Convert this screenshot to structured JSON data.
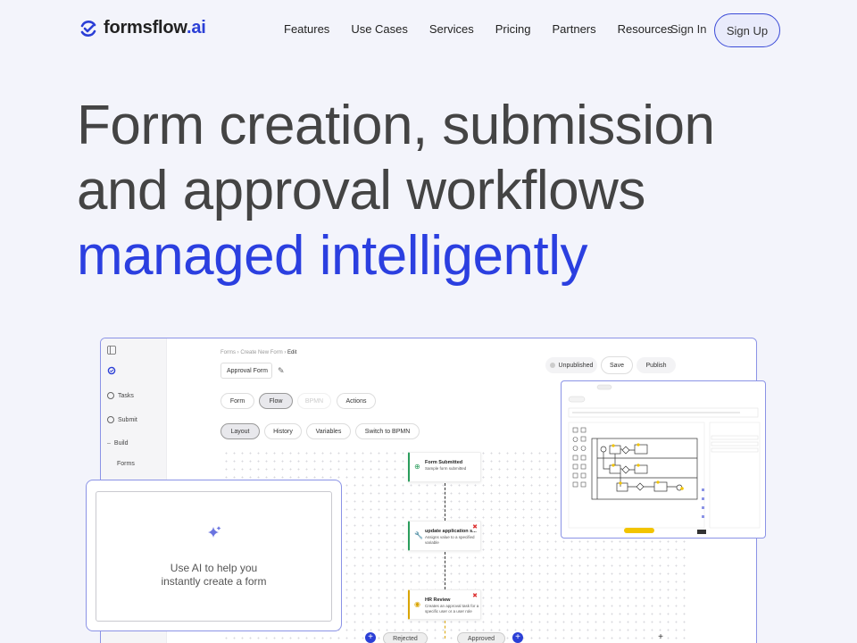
{
  "brand": {
    "name": "formsflow",
    "suffix": ".ai",
    "accent": "#2b3fd6"
  },
  "nav": {
    "links": [
      "Features",
      "Use Cases",
      "Services",
      "Pricing",
      "Partners",
      "Resources"
    ],
    "sign_in": "Sign In",
    "sign_up": "Sign Up"
  },
  "hero": {
    "line1": "Form creation, submission",
    "line2": "and approval workflows",
    "line3": "managed intelligently"
  },
  "app": {
    "sidebar": {
      "tasks": "Tasks",
      "submit": "Submit",
      "build": "Build",
      "forms": "Forms"
    },
    "breadcrumb": {
      "a": "Forms",
      "b": "Create New Form",
      "c": "Edit"
    },
    "form_name": "Approval Form",
    "status": "Unpublished",
    "save": "Save",
    "publish": "Publish",
    "tabs": [
      "Form",
      "Flow",
      "BPMN",
      "Actions"
    ],
    "subtabs": [
      "Layout",
      "History",
      "Variables",
      "Switch to BPMN"
    ],
    "nodes": [
      {
        "title": "Form Submitted",
        "desc": "Sample form submitted"
      },
      {
        "title": "update application s...",
        "desc": "Assigns value to a specified variable"
      },
      {
        "title": "HR Review",
        "desc": "Creates an approval task for a specific user or a user role"
      }
    ],
    "branches": {
      "rejected": "Rejected",
      "approved": "Approved"
    }
  },
  "ai_card": {
    "line1": "Use AI to help you",
    "line2": "instantly create a form"
  }
}
